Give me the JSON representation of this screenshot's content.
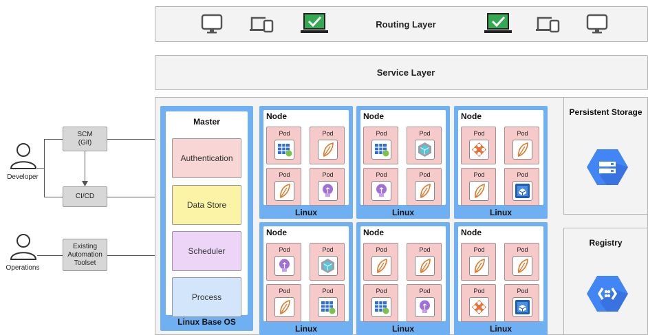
{
  "routing_layer": {
    "label": "Routing Layer"
  },
  "service_layer": {
    "label": "Service Layer"
  },
  "actors": [
    {
      "label": "Developer"
    },
    {
      "label": "Operations"
    }
  ],
  "tools": [
    {
      "label": "SCM\n(Git)"
    },
    {
      "label": "CI/CD"
    },
    {
      "label": "Existing\nAutomation\nToolset"
    }
  ],
  "master": {
    "title": "Master",
    "components": [
      "Authentication",
      "Data Store",
      "Scheduler",
      "Process"
    ],
    "component_colors": [
      "#f9d6d6",
      "#fbf4a6",
      "#ecd5f7",
      "#d3e5fb"
    ],
    "footer": "Linux Base OS"
  },
  "nodes": [
    {
      "title": "Node",
      "os": "Linux",
      "pods": [
        {
          "label": "Pod",
          "icon": "grid-icon"
        },
        {
          "label": "Pod",
          "icon": "feather-icon"
        },
        {
          "label": "Pod",
          "icon": "feather-icon"
        },
        {
          "label": "Pod",
          "icon": "bulb-icon"
        }
      ]
    },
    {
      "title": "Node",
      "os": "Linux",
      "pods": [
        {
          "label": "Pod",
          "icon": "grid-icon"
        },
        {
          "label": "Pod",
          "icon": "cube-icon"
        },
        {
          "label": "Pod",
          "icon": "bulb-icon"
        },
        {
          "label": "Pod",
          "icon": "feather-icon"
        }
      ]
    },
    {
      "title": "Node",
      "os": "Linux",
      "pods": [
        {
          "label": "Pod",
          "icon": "network-icon"
        },
        {
          "label": "Pod",
          "icon": "feather-icon"
        },
        {
          "label": "Pod",
          "icon": "feather-icon"
        },
        {
          "label": "Pod",
          "icon": "container-icon"
        }
      ]
    },
    {
      "title": "Node",
      "os": "Linux",
      "pods": [
        {
          "label": "Pod",
          "icon": "bulb-icon"
        },
        {
          "label": "Pod",
          "icon": "cube-icon"
        },
        {
          "label": "Pod",
          "icon": "feather-icon"
        },
        {
          "label": "Pod",
          "icon": "grid-icon"
        }
      ]
    },
    {
      "title": "Node",
      "os": "Linux",
      "pods": [
        {
          "label": "Pod",
          "icon": "feather-icon"
        },
        {
          "label": "Pod",
          "icon": "feather-icon"
        },
        {
          "label": "Pod",
          "icon": "grid-icon"
        },
        {
          "label": "Pod",
          "icon": "bulb-icon"
        }
      ]
    },
    {
      "title": "Node",
      "os": "Linux",
      "pods": [
        {
          "label": "Pod",
          "icon": "feather-icon"
        },
        {
          "label": "Pod",
          "icon": "feather-icon"
        },
        {
          "label": "Pod",
          "icon": "network-icon"
        },
        {
          "label": "Pod",
          "icon": "container-icon"
        }
      ]
    }
  ],
  "persistent_storage": {
    "title": "Persistent Storage",
    "icon": "storage-icon"
  },
  "registry": {
    "title": "Registry",
    "icon": "registry-icon"
  },
  "colors": {
    "node_blue": "#6fb0f2",
    "pod_pink": "#f7caca",
    "gcp_blue": "#4285f4",
    "check_green": "#34a853"
  }
}
